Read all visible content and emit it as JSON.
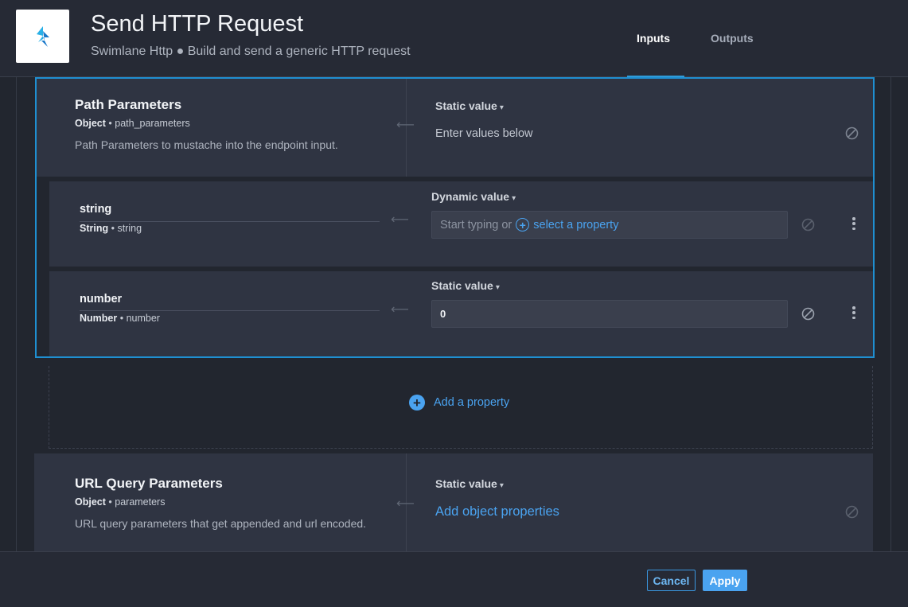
{
  "header": {
    "title": "Send HTTP Request",
    "subtitle": "Swimlane Http ● Build and send a generic HTTP request",
    "tabs": [
      {
        "label": "Inputs",
        "active": true
      },
      {
        "label": "Outputs",
        "active": false
      }
    ],
    "accent_color": "#1f8fd1"
  },
  "path_parameters": {
    "title": "Path Parameters",
    "type_label": "Object",
    "key": "path_parameters",
    "description": "Path Parameters to mustache into the endpoint input.",
    "mode": "Static value",
    "value_text": "Enter values below",
    "properties": [
      {
        "name": "string",
        "type_label": "String",
        "key": "string",
        "mode": "Dynamic value",
        "placeholder": "Start typing or",
        "select_link": "select a property"
      },
      {
        "name": "number",
        "type_label": "Number",
        "key": "number",
        "mode": "Static value",
        "value": "0"
      }
    ],
    "add_property_label": "Add a property"
  },
  "url_query_parameters": {
    "title": "URL Query Parameters",
    "type_label": "Object",
    "key": "parameters",
    "description": "URL query parameters that get appended and url encoded.",
    "mode": "Static value",
    "link_text": "Add object properties"
  },
  "footer": {
    "cancel_label": "Cancel",
    "apply_label": "Apply"
  },
  "icons": {
    "logo": "swimlane-logo-icon",
    "arrow": "arrow-left-icon",
    "null": "null-circle-icon",
    "menu": "kebab-menu-icon",
    "chevron": "chevron-down-icon",
    "add": "plus-circle-icon"
  }
}
